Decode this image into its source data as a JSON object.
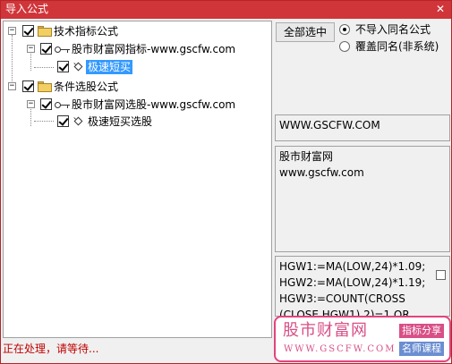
{
  "window": {
    "title": "导入公式",
    "close_glyph": "✕",
    "accent_color": "#d0353a"
  },
  "tree": {
    "nodes": [
      {
        "label": "技术指标公式",
        "checked": true,
        "expanded": true,
        "icon": "folder-icon"
      },
      {
        "label": "股市财富网指标-www.gscfw.com",
        "checked": true,
        "expanded": true,
        "icon": "key-icon"
      },
      {
        "label": "极速短买",
        "checked": true,
        "selected": true,
        "icon": "formula-icon"
      },
      {
        "label": "条件选股公式",
        "checked": true,
        "expanded": true,
        "icon": "folder-icon"
      },
      {
        "label": "股市财富网选股-www.gscfw.com",
        "checked": true,
        "expanded": true,
        "icon": "key-icon"
      },
      {
        "label": "极速短买选股",
        "checked": true,
        "icon": "formula-icon"
      }
    ],
    "expander_glyph": "−"
  },
  "controls": {
    "select_all_label": "全部选中",
    "option_no_import_label": "不导入同名公式",
    "option_overwrite_label": "覆盖同名(非系统)",
    "selected_option": "no_import"
  },
  "info": {
    "website": "WWW.GSCFW.COM",
    "description": "股市财富网\nwww.gscfw.com",
    "formula_text": "HGW1:=MA(LOW,24)*1.09;\nHGW2:=MA(LOW,24)*1.19;\nHGW3:=COUNT(CROSS\n(CLOSE,HGW1),2)=1 OR"
  },
  "status": {
    "text": "正在处理，请等待..."
  },
  "watermark": {
    "brand": "股市财富网",
    "url": "WWW.GSCFW.COM",
    "tag1": "指标分享",
    "tag2": "名师课程",
    "color": "#d84f86"
  }
}
